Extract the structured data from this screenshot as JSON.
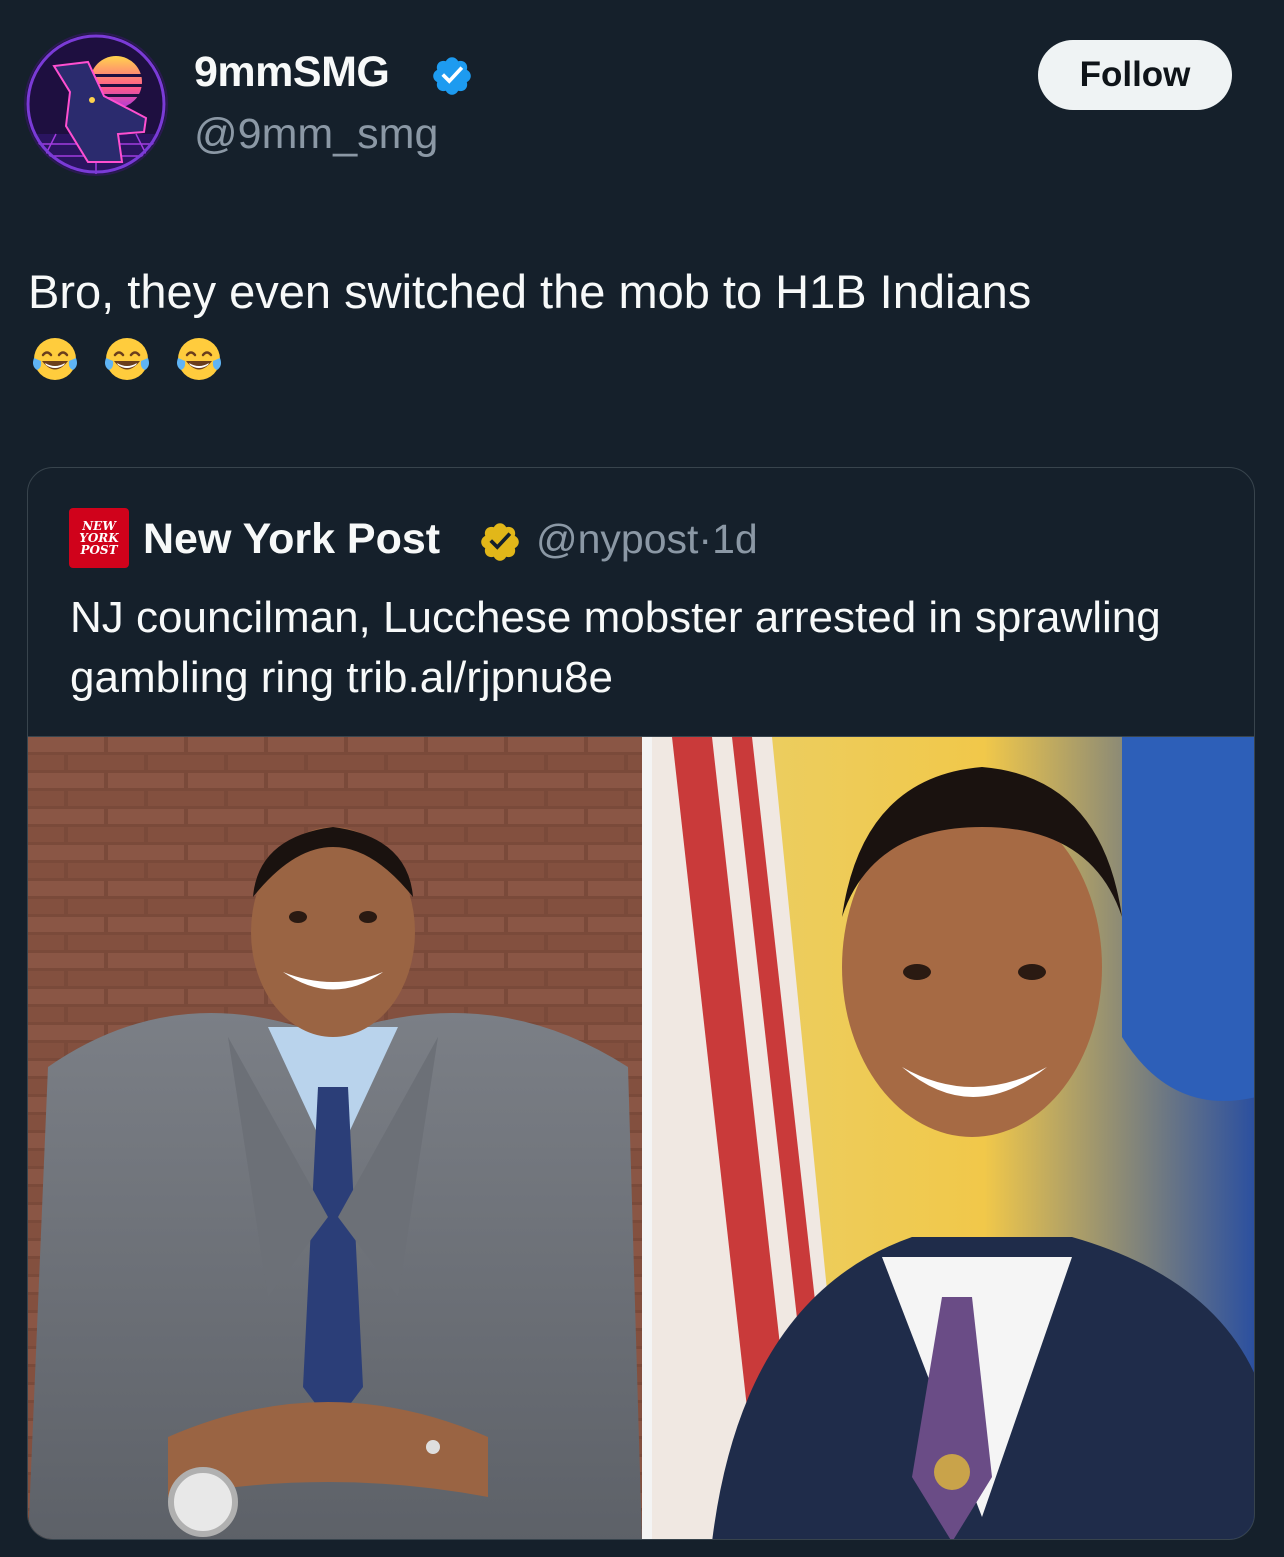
{
  "author": {
    "display_name": "9mmSMG",
    "handle": "@9mm_smg",
    "verified": true,
    "verified_color": "#1d9bf0"
  },
  "follow_label": "Follow",
  "tweet": {
    "text": "Bro, they even switched the mob to H1B Indians",
    "emojis": [
      "face-with-tears-of-joy",
      "face-with-tears-of-joy",
      "face-with-tears-of-joy"
    ]
  },
  "quoted": {
    "logo_lines": [
      "NEW",
      "YORK",
      "POST"
    ],
    "display_name": "New York Post",
    "verified_color": "#e2b719",
    "handle": "@nypost",
    "separator": "·",
    "age": "1d",
    "text": "NJ councilman, Lucchese mobster arrested in sprawling gambling ring trib.al/rjpnu8e",
    "photos": [
      "photo-left",
      "photo-right"
    ]
  }
}
